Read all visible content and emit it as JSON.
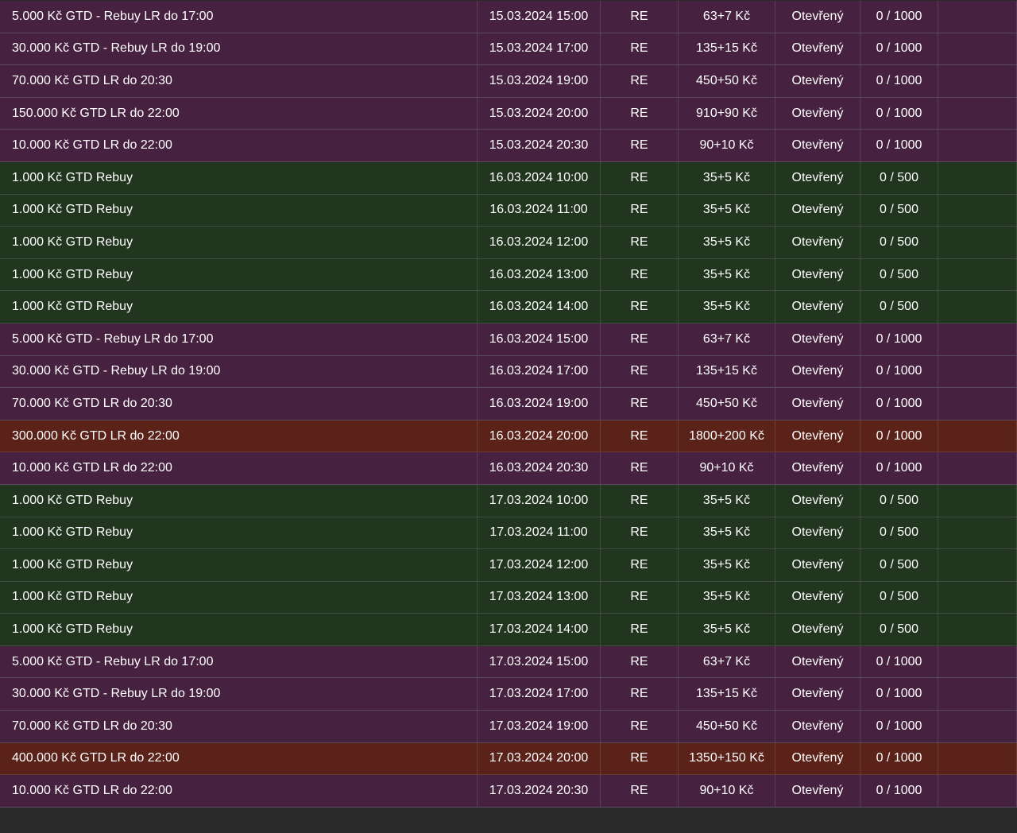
{
  "tournaments": [
    {
      "name": "5.000 Kč GTD - Rebuy LR do 17:00",
      "date": "15.03.2024 15:00",
      "type": "RE",
      "buyin": "63+7 Kč",
      "status": "Otevřený",
      "players": "0 / 1000",
      "color": "purple"
    },
    {
      "name": "30.000 Kč GTD - Rebuy LR do 19:00",
      "date": "15.03.2024 17:00",
      "type": "RE",
      "buyin": "135+15 Kč",
      "status": "Otevřený",
      "players": "0 / 1000",
      "color": "purple"
    },
    {
      "name": "70.000 Kč GTD LR do 20:30",
      "date": "15.03.2024 19:00",
      "type": "RE",
      "buyin": "450+50 Kč",
      "status": "Otevřený",
      "players": "0 / 1000",
      "color": "purple"
    },
    {
      "name": "150.000 Kč GTD LR do 22:00",
      "date": "15.03.2024 20:00",
      "type": "RE",
      "buyin": "910+90 Kč",
      "status": "Otevřený",
      "players": "0 / 1000",
      "color": "purple"
    },
    {
      "name": "10.000 Kč GTD LR do 22:00",
      "date": "15.03.2024 20:30",
      "type": "RE",
      "buyin": "90+10 Kč",
      "status": "Otevřený",
      "players": "0 / 1000",
      "color": "purple"
    },
    {
      "name": "1.000 Kč GTD Rebuy",
      "date": "16.03.2024 10:00",
      "type": "RE",
      "buyin": "35+5 Kč",
      "status": "Otevřený",
      "players": "0 / 500",
      "color": "green"
    },
    {
      "name": "1.000 Kč GTD Rebuy",
      "date": "16.03.2024 11:00",
      "type": "RE",
      "buyin": "35+5 Kč",
      "status": "Otevřený",
      "players": "0 / 500",
      "color": "green"
    },
    {
      "name": "1.000 Kč GTD Rebuy",
      "date": "16.03.2024 12:00",
      "type": "RE",
      "buyin": "35+5 Kč",
      "status": "Otevřený",
      "players": "0 / 500",
      "color": "green"
    },
    {
      "name": "1.000 Kč GTD Rebuy",
      "date": "16.03.2024 13:00",
      "type": "RE",
      "buyin": "35+5 Kč",
      "status": "Otevřený",
      "players": "0 / 500",
      "color": "green"
    },
    {
      "name": "1.000 Kč GTD Rebuy",
      "date": "16.03.2024 14:00",
      "type": "RE",
      "buyin": "35+5 Kč",
      "status": "Otevřený",
      "players": "0 / 500",
      "color": "green"
    },
    {
      "name": "5.000 Kč GTD - Rebuy LR do 17:00",
      "date": "16.03.2024 15:00",
      "type": "RE",
      "buyin": "63+7 Kč",
      "status": "Otevřený",
      "players": "0 / 1000",
      "color": "purple"
    },
    {
      "name": "30.000 Kč GTD - Rebuy LR do 19:00",
      "date": "16.03.2024 17:00",
      "type": "RE",
      "buyin": "135+15 Kč",
      "status": "Otevřený",
      "players": "0 / 1000",
      "color": "purple"
    },
    {
      "name": "70.000 Kč GTD LR do 20:30",
      "date": "16.03.2024 19:00",
      "type": "RE",
      "buyin": "450+50 Kč",
      "status": "Otevřený",
      "players": "0 / 1000",
      "color": "purple"
    },
    {
      "name": "300.000 Kč GTD LR do 22:00",
      "date": "16.03.2024 20:00",
      "type": "RE",
      "buyin": "1800+200 Kč",
      "status": "Otevřený",
      "players": "0 / 1000",
      "color": "red"
    },
    {
      "name": "10.000 Kč GTD LR do 22:00",
      "date": "16.03.2024 20:30",
      "type": "RE",
      "buyin": "90+10 Kč",
      "status": "Otevřený",
      "players": "0 / 1000",
      "color": "purple"
    },
    {
      "name": "1.000 Kč GTD Rebuy",
      "date": "17.03.2024 10:00",
      "type": "RE",
      "buyin": "35+5 Kč",
      "status": "Otevřený",
      "players": "0 / 500",
      "color": "green"
    },
    {
      "name": "1.000 Kč GTD Rebuy",
      "date": "17.03.2024 11:00",
      "type": "RE",
      "buyin": "35+5 Kč",
      "status": "Otevřený",
      "players": "0 / 500",
      "color": "green"
    },
    {
      "name": "1.000 Kč GTD Rebuy",
      "date": "17.03.2024 12:00",
      "type": "RE",
      "buyin": "35+5 Kč",
      "status": "Otevřený",
      "players": "0 / 500",
      "color": "green"
    },
    {
      "name": "1.000 Kč GTD Rebuy",
      "date": "17.03.2024 13:00",
      "type": "RE",
      "buyin": "35+5 Kč",
      "status": "Otevřený",
      "players": "0 / 500",
      "color": "green"
    },
    {
      "name": "1.000 Kč GTD Rebuy",
      "date": "17.03.2024 14:00",
      "type": "RE",
      "buyin": "35+5 Kč",
      "status": "Otevřený",
      "players": "0 / 500",
      "color": "green"
    },
    {
      "name": "5.000 Kč GTD - Rebuy LR do 17:00",
      "date": "17.03.2024 15:00",
      "type": "RE",
      "buyin": "63+7 Kč",
      "status": "Otevřený",
      "players": "0 / 1000",
      "color": "purple"
    },
    {
      "name": "30.000 Kč GTD - Rebuy LR do 19:00",
      "date": "17.03.2024 17:00",
      "type": "RE",
      "buyin": "135+15 Kč",
      "status": "Otevřený",
      "players": "0 / 1000",
      "color": "purple"
    },
    {
      "name": "70.000 Kč GTD LR do 20:30",
      "date": "17.03.2024 19:00",
      "type": "RE",
      "buyin": "450+50 Kč",
      "status": "Otevřený",
      "players": "0 / 1000",
      "color": "purple"
    },
    {
      "name": "400.000 Kč GTD LR do 22:00",
      "date": "17.03.2024 20:00",
      "type": "RE",
      "buyin": "1350+150 Kč",
      "status": "Otevřený",
      "players": "0 / 1000",
      "color": "red"
    },
    {
      "name": "10.000 Kč GTD LR do 22:00",
      "date": "17.03.2024 20:30",
      "type": "RE",
      "buyin": "90+10 Kč",
      "status": "Otevřený",
      "players": "0 / 1000",
      "color": "purple"
    }
  ]
}
